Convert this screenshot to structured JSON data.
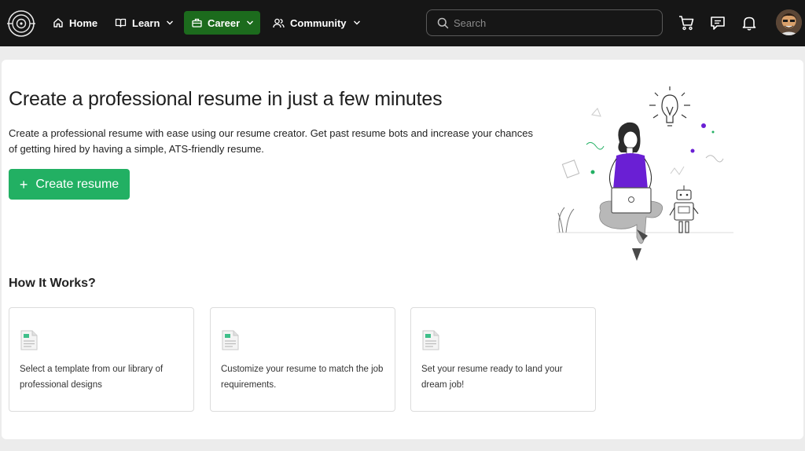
{
  "nav": {
    "home_label": "Home",
    "learn_label": "Learn",
    "career_label": "Career",
    "community_label": "Community",
    "search_placeholder": "Search",
    "active_color": "#1c6b1d"
  },
  "main": {
    "title": "Create a professional resume in just a few minutes",
    "description": "Create a professional resume with ease using our resume creator. Get past resume bots and increase your chances of getting hired by having a simple, ATS-friendly resume.",
    "create_button_icon": "+",
    "create_button_label": "Create resume",
    "button_color": "#22b063"
  },
  "how_it_works": {
    "title": "How It Works?",
    "steps": [
      {
        "icon": "document-icon",
        "text": "Select a template from our library of professional designs"
      },
      {
        "icon": "document-icon",
        "text": "Customize your resume to match the job requirements."
      },
      {
        "icon": "document-icon",
        "text": "Set your resume ready to land your dream job!"
      }
    ]
  }
}
